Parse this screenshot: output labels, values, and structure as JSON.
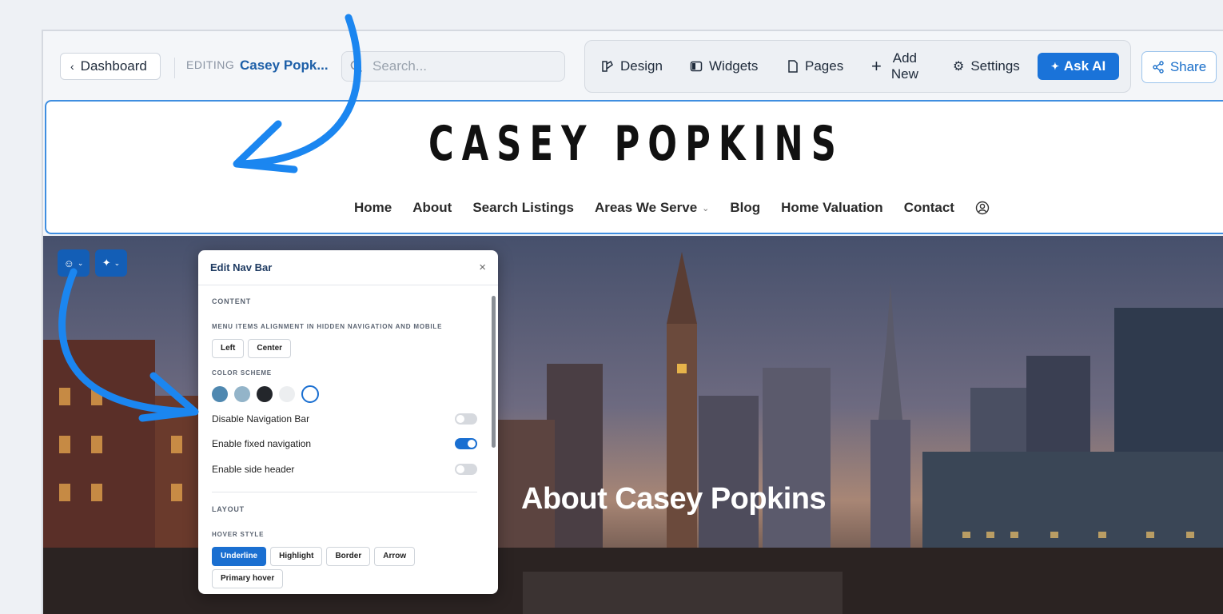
{
  "toolbar": {
    "dashboard_label": "Dashboard",
    "editing_label": "EDITING",
    "editing_site": "Casey Popk...",
    "search_placeholder": "Search...",
    "design_label": "Design",
    "widgets_label": "Widgets",
    "pages_label": "Pages",
    "add_new_line1": "Add",
    "add_new_line2": "New",
    "settings_label": "Settings",
    "ask_ai_label": "Ask AI",
    "share_label": "Share"
  },
  "site": {
    "title": "CASEY POPKINS",
    "nav": [
      "Home",
      "About",
      "Search Listings",
      "Areas We Serve",
      "Blog",
      "Home Valuation",
      "Contact"
    ]
  },
  "hero": {
    "title": "About Casey Popkins"
  },
  "panel": {
    "title": "Edit Nav Bar",
    "close": "×",
    "content_label": "CONTENT",
    "alignment_label": "MENU ITEMS ALIGNMENT IN HIDDEN NAVIGATION AND MOBILE",
    "alignment_options": [
      "Left",
      "Center"
    ],
    "color_scheme_label": "COLOR SCHEME",
    "color_swatches": [
      "#4f88b0",
      "#93b4c9",
      "#23262b",
      "#eceef0",
      "#ffffff"
    ],
    "toggles": [
      {
        "label": "Disable Navigation Bar",
        "on": false
      },
      {
        "label": "Enable fixed navigation",
        "on": true
      },
      {
        "label": "Enable side header",
        "on": false
      }
    ],
    "layout_label": "LAYOUT",
    "hover_style_label": "HOVER STYLE",
    "hover_options": [
      "Underline",
      "Highlight",
      "Border",
      "Arrow",
      "Primary hover"
    ],
    "hover_selected": "Underline"
  },
  "colors": {
    "accent": "#1a73d9",
    "annotation_arrow": "#1b86f0"
  }
}
